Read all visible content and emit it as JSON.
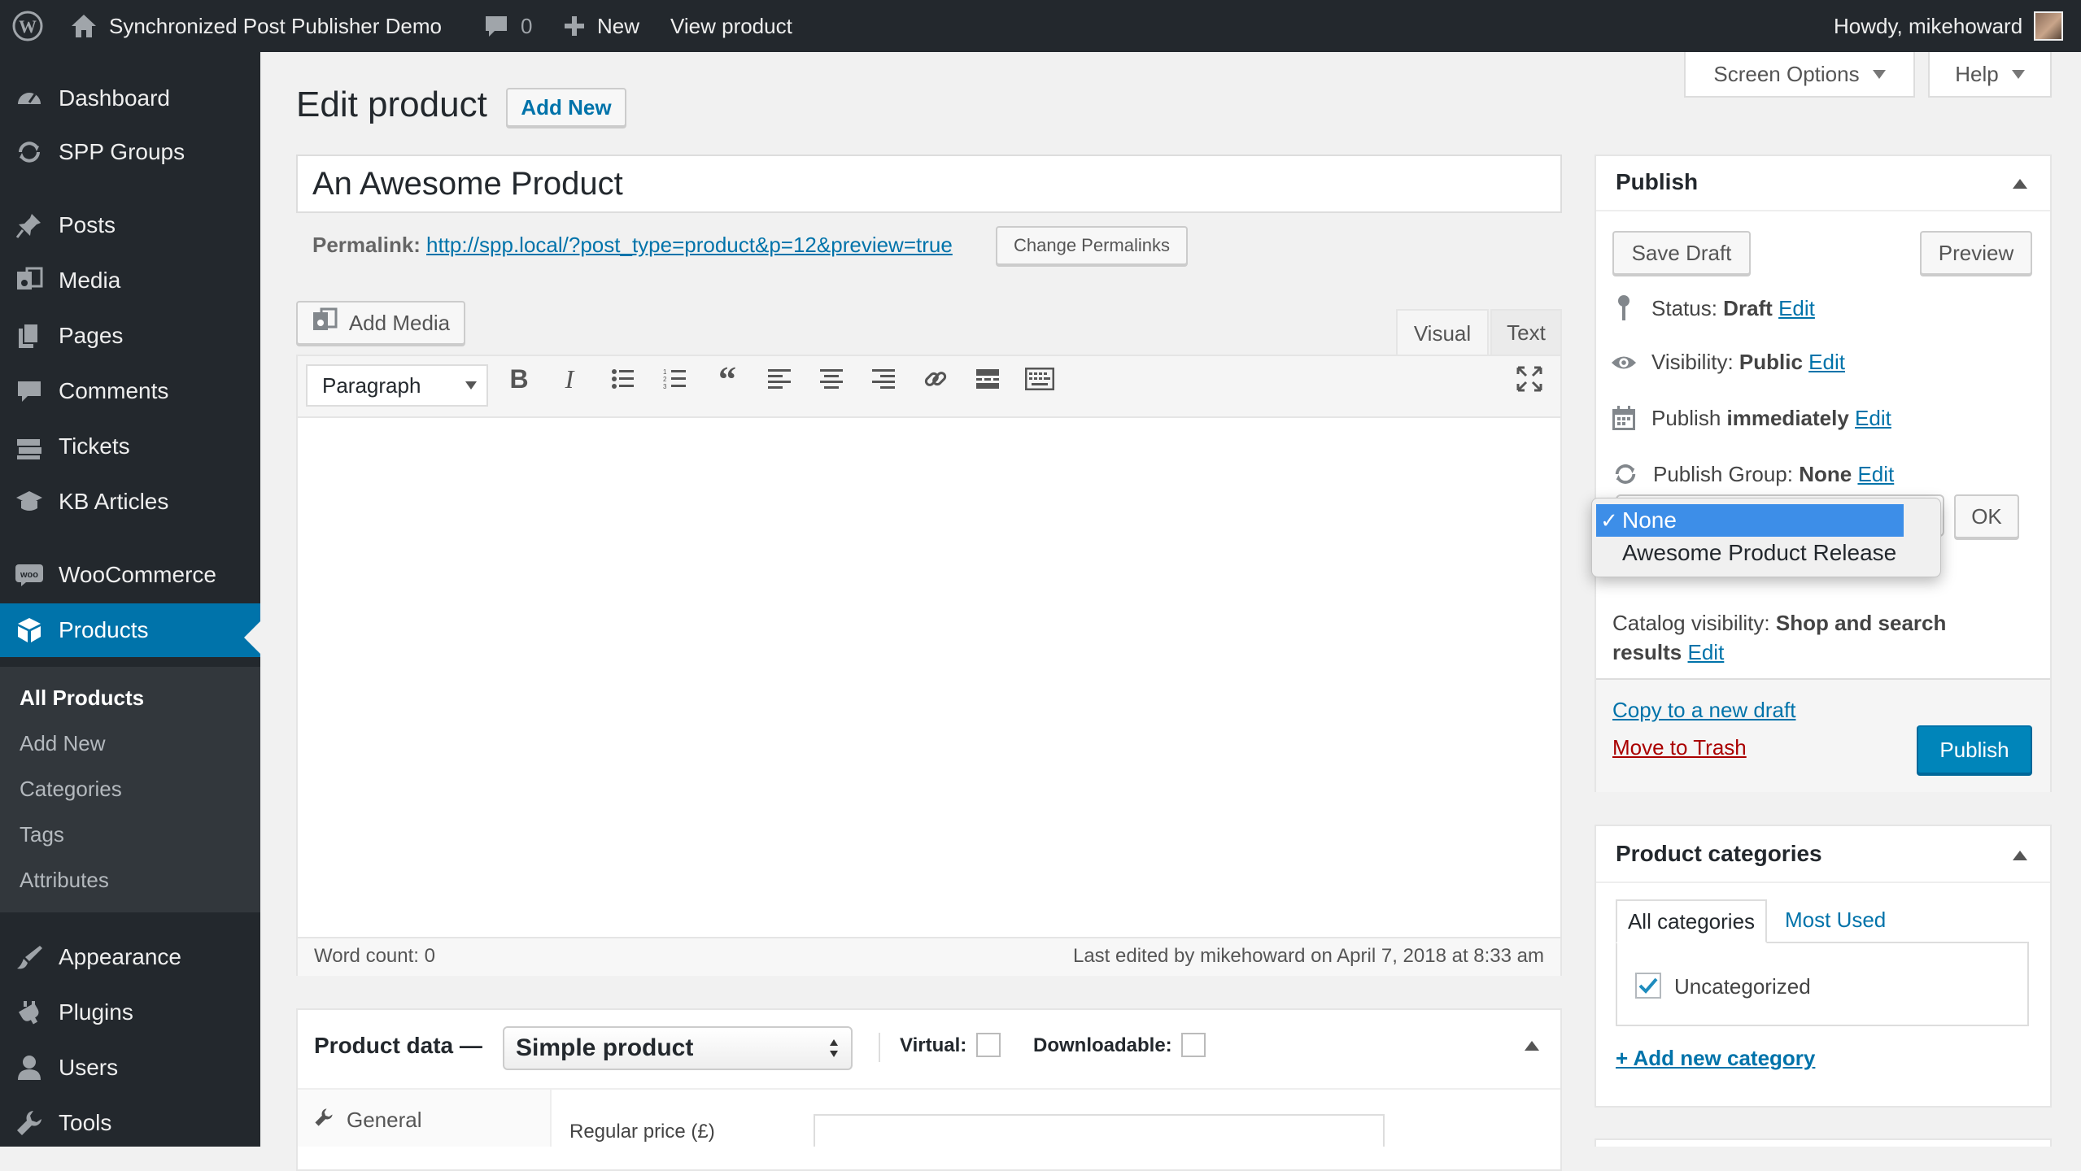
{
  "admin_bar": {
    "site_name": "Synchronized Post Publisher Demo",
    "comments_count": "0",
    "new_label": "New",
    "view_label": "View product",
    "howdy": "Howdy, mikehoward"
  },
  "sidebar": {
    "items": [
      {
        "label": "Dashboard",
        "icon": "dashboard-icon"
      },
      {
        "label": "SPP Groups",
        "icon": "sync-icon"
      },
      {
        "label": "Posts",
        "icon": "pin-icon"
      },
      {
        "label": "Media",
        "icon": "media-icon"
      },
      {
        "label": "Pages",
        "icon": "pages-icon"
      },
      {
        "label": "Comments",
        "icon": "comment-icon"
      },
      {
        "label": "Tickets",
        "icon": "tickets-icon"
      },
      {
        "label": "KB Articles",
        "icon": "kb-icon"
      },
      {
        "label": "WooCommerce",
        "icon": "woo-icon"
      },
      {
        "label": "Products",
        "icon": "products-icon"
      },
      {
        "label": "Appearance",
        "icon": "brush-icon"
      },
      {
        "label": "Plugins",
        "icon": "plugin-icon"
      },
      {
        "label": "Users",
        "icon": "users-icon"
      },
      {
        "label": "Tools",
        "icon": "wrench-icon"
      }
    ],
    "submenu": [
      "All Products",
      "Add New",
      "Categories",
      "Tags",
      "Attributes"
    ]
  },
  "screen_meta": {
    "screen_options": "Screen Options",
    "help": "Help"
  },
  "page": {
    "title": "Edit product",
    "add_new": "Add New",
    "post_title": "An Awesome Product",
    "permalink_label": "Permalink:",
    "permalink_url": "http://spp.local/?post_type=product&p=12&preview=true",
    "change_permalinks": "Change Permalinks"
  },
  "editor": {
    "add_media": "Add Media",
    "tab_visual": "Visual",
    "tab_text": "Text",
    "format_select": "Paragraph",
    "word_count": "Word count: 0",
    "last_edited": "Last edited by mikehoward on April 7, 2018 at 8:33 am"
  },
  "product_data": {
    "label": "Product data —",
    "type_select": "Simple product",
    "virtual": "Virtual:",
    "downloadable": "Downloadable:",
    "tab_general": "General",
    "regular_price": "Regular price (£)"
  },
  "publish_box": {
    "title": "Publish",
    "save_draft": "Save Draft",
    "preview": "Preview",
    "status_label": "Status:",
    "status_value": "Draft",
    "visibility_label": "Visibility:",
    "visibility_value": "Public",
    "publish_label": "Publish",
    "publish_value": "immediately",
    "group_label": "Publish Group:",
    "group_value": "None",
    "edit": "Edit",
    "ok": "OK",
    "dropdown_options": [
      "None",
      "Awesome Product Release"
    ],
    "catalog_label": "Catalog visibility:",
    "catalog_value_1": "Shop and search",
    "catalog_value_2": "results",
    "copy_draft": "Copy to a new draft",
    "move_trash": "Move to Trash",
    "publish_btn": "Publish"
  },
  "categories_box": {
    "title": "Product categories",
    "tab_all": "All categories",
    "tab_most": "Most Used",
    "item": "Uncategorized",
    "add_new": "+ Add new category"
  },
  "colors": {
    "admin_dark": "#23282d",
    "accent": "#0073aa",
    "primary_button": "#0085ba",
    "trash_red": "#a00",
    "dropdown_highlight": "#3d8ee8"
  }
}
